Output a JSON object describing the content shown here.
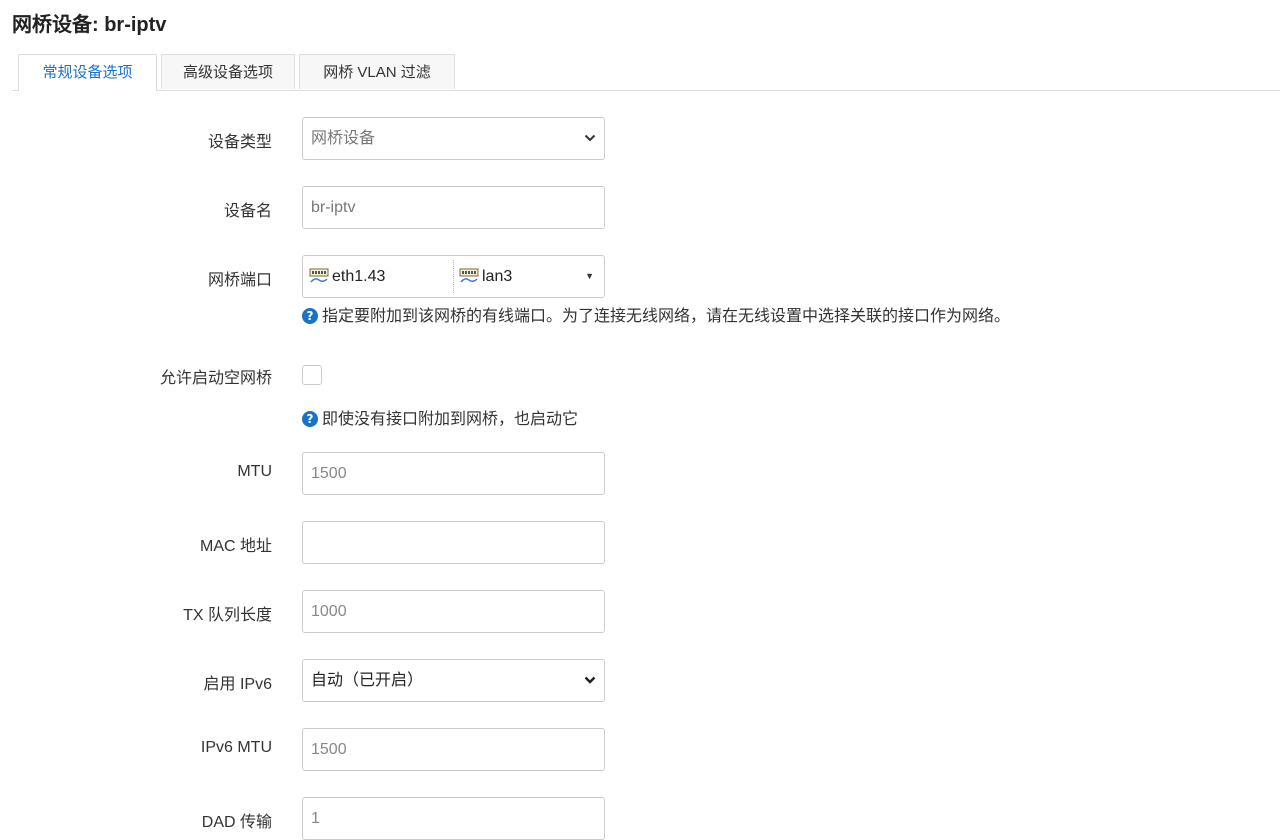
{
  "title": "网桥设备: br-iptv",
  "tabs": [
    {
      "label": "常规设备选项",
      "active": true
    },
    {
      "label": "高级设备选项",
      "active": false
    },
    {
      "label": "网桥 VLAN 过滤",
      "active": false
    }
  ],
  "fields": {
    "device_type": {
      "label": "设备类型",
      "value": "网桥设备"
    },
    "device_name": {
      "label": "设备名",
      "value": "br-iptv"
    },
    "bridge_ports": {
      "label": "网桥端口",
      "ports": [
        "eth1.43",
        "lan3"
      ],
      "help": "指定要附加到该网桥的有线端口。为了连接无线网络，请在无线设置中选择关联的接口作为网络。"
    },
    "bring_up_empty": {
      "label": "允许启动空网桥",
      "checked": false,
      "help": "即使没有接口附加到网桥，也启动它"
    },
    "mtu": {
      "label": "MTU",
      "placeholder": "1500"
    },
    "mac": {
      "label": "MAC 地址",
      "placeholder": ""
    },
    "txqueuelen": {
      "label": "TX 队列长度",
      "placeholder": "1000"
    },
    "ipv6": {
      "label": "启用 IPv6",
      "value": "自动（已开启）"
    },
    "ipv6_mtu": {
      "label": "IPv6 MTU",
      "placeholder": "1500"
    },
    "dad": {
      "label": "DAD 传输",
      "placeholder": "1"
    }
  },
  "icons": {
    "help": "question-circle-icon",
    "port": "network-port-icon",
    "dropdown": "chevron-down-icon"
  },
  "colors": {
    "accent": "#1a73c8",
    "border": "#cccccc"
  }
}
